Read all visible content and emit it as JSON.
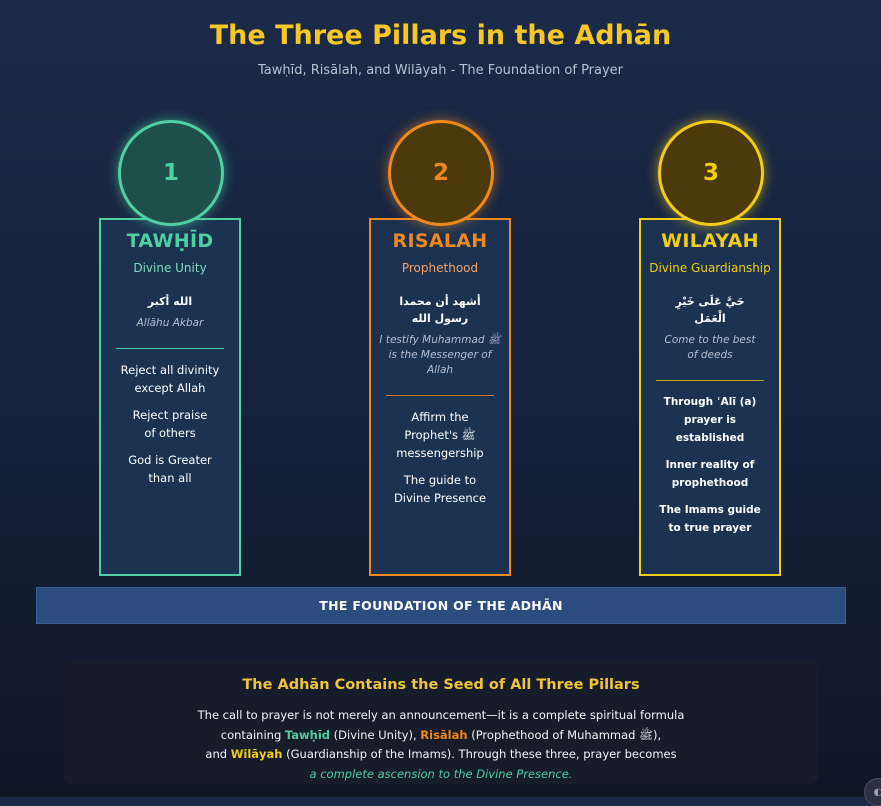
{
  "header": {
    "title": "The Three Pillars in the Adhān",
    "subtitle": "Tawḥīd, Risālah, and Wilāyah - The Foundation of Prayer"
  },
  "pillars": [
    {
      "number": "1",
      "title": "TAWḤĪD",
      "subtitle": "Divine Unity",
      "arabic_lines": [
        "الله أكبر"
      ],
      "translit_lines": [
        "Allāhu Akbar"
      ],
      "points": [
        [
          "Reject all divinity",
          "except Allah"
        ],
        [
          "Reject praise",
          "of others"
        ],
        [
          "God is Greater",
          "than all"
        ]
      ],
      "color": "#4fcfa2"
    },
    {
      "number": "2",
      "title": "RISALAH",
      "subtitle": "Prophethood",
      "arabic_lines": [
        "أشهد أن محمدا",
        "رسول الله"
      ],
      "translit_lines": [
        "I testify Muhammad ﷺ",
        "is the Messenger of Allah"
      ],
      "points": [
        [
          "Affirm the",
          "Prophet's ﷺ",
          "messengership"
        ],
        [
          "The guide to",
          "Divine Presence"
        ]
      ],
      "color": "#f0891c"
    },
    {
      "number": "3",
      "title": "WILAYAH",
      "subtitle": "Divine Guardianship",
      "arabic_lines": [
        "حَيَّ عَلَى خَيْرِ",
        "الْعَمَل"
      ],
      "translit_lines": [
        "Come to the best",
        "of deeds"
      ],
      "points": [
        [
          "Through ʿAlī (a)",
          "prayer is established"
        ],
        [
          "Inner reality of",
          "prophethood"
        ],
        [
          "The Imams guide",
          "to true prayer"
        ]
      ],
      "color": "#f1cd16"
    }
  ],
  "foundation_label": "THE FOUNDATION OF THE ADHĀN",
  "summary": {
    "title": "The Adhān Contains the Seed of All Three Pillars",
    "text_1": "The call to prayer is not merely an announcement—it is a complete spiritual formula",
    "text_2a": "containing ",
    "term_1": "Tawḥīd",
    "text_2b": " (Divine Unity), ",
    "term_2": "Risālah",
    "text_2c": " (Prophethood of Muhammad ﷺ),",
    "text_3a": "and ",
    "term_3": "Wilāyah",
    "text_3b": " (Guardianship of the Imams). Through these three, prayer becomes",
    "closing": "a complete ascension to the Divine Presence."
  },
  "colors": {
    "accent_title": "#f7c823",
    "tawhid": "#4fcfa2",
    "risalah": "#f0891c",
    "wilayah": "#f1cd16",
    "foundation_bar": "#2c4c80"
  }
}
